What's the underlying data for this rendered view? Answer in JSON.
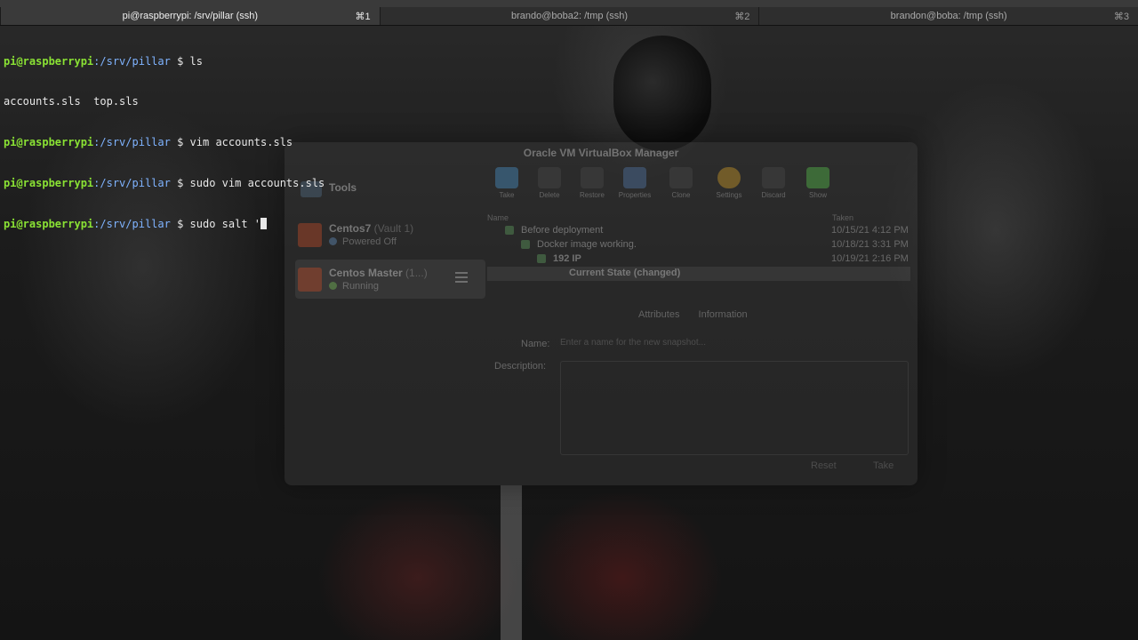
{
  "tabs": [
    {
      "title": "pi@raspberrypi: /srv/pillar (ssh)",
      "shortcut": "⌘1",
      "active": true
    },
    {
      "title": "brando@boba2: /tmp (ssh)",
      "shortcut": "⌘2",
      "active": false
    },
    {
      "title": "brandon@boba: /tmp (ssh)",
      "shortcut": "⌘3",
      "active": false
    }
  ],
  "terminal": {
    "prompt_user": "pi@raspberrypi",
    "prompt_path": ":/srv/pillar",
    "prompt_symbol": " $ ",
    "lines": [
      {
        "type": "cmd",
        "text": "ls"
      },
      {
        "type": "out",
        "text": "accounts.sls  top.sls"
      },
      {
        "type": "cmd",
        "text": "vim accounts.sls"
      },
      {
        "type": "cmd",
        "text": "sudo vim accounts.sls"
      },
      {
        "type": "cmd",
        "text": "sudo salt '",
        "cursor": true
      }
    ]
  },
  "virtualbox": {
    "title": "Oracle VM VirtualBox Manager",
    "tools_label": "Tools",
    "vms": [
      {
        "name": "Centos7",
        "group": " (Vault 1)",
        "state": "Powered Off",
        "state_color": "#5a7fa8"
      },
      {
        "name": "Centos Master",
        "group": " (1...)",
        "state": "Running",
        "state_color": "#6aa84f"
      }
    ],
    "toolbar": [
      "Take",
      "Delete",
      "Restore",
      "Properties",
      "Clone",
      "Settings",
      "Discard",
      "Show"
    ],
    "snapshot_headers": {
      "name": "Name",
      "taken": "Taken"
    },
    "snapshots": [
      {
        "name": "Before deployment",
        "taken": "10/15/21 4:12 PM",
        "indent": 1
      },
      {
        "name": "Docker image working.",
        "taken": "10/18/21 3:31 PM",
        "indent": 2
      },
      {
        "name": "192 IP",
        "taken": "10/19/21 2:16 PM",
        "indent": 3
      },
      {
        "name": "Current State (changed)",
        "taken": "",
        "indent": 4
      }
    ],
    "detail_tabs": [
      "Attributes",
      "Information"
    ],
    "name_label": "Name:",
    "name_placeholder": "Enter a name for the new snapshot...",
    "description_label": "Description:",
    "reset_label": "Reset",
    "take_label": "Take"
  }
}
